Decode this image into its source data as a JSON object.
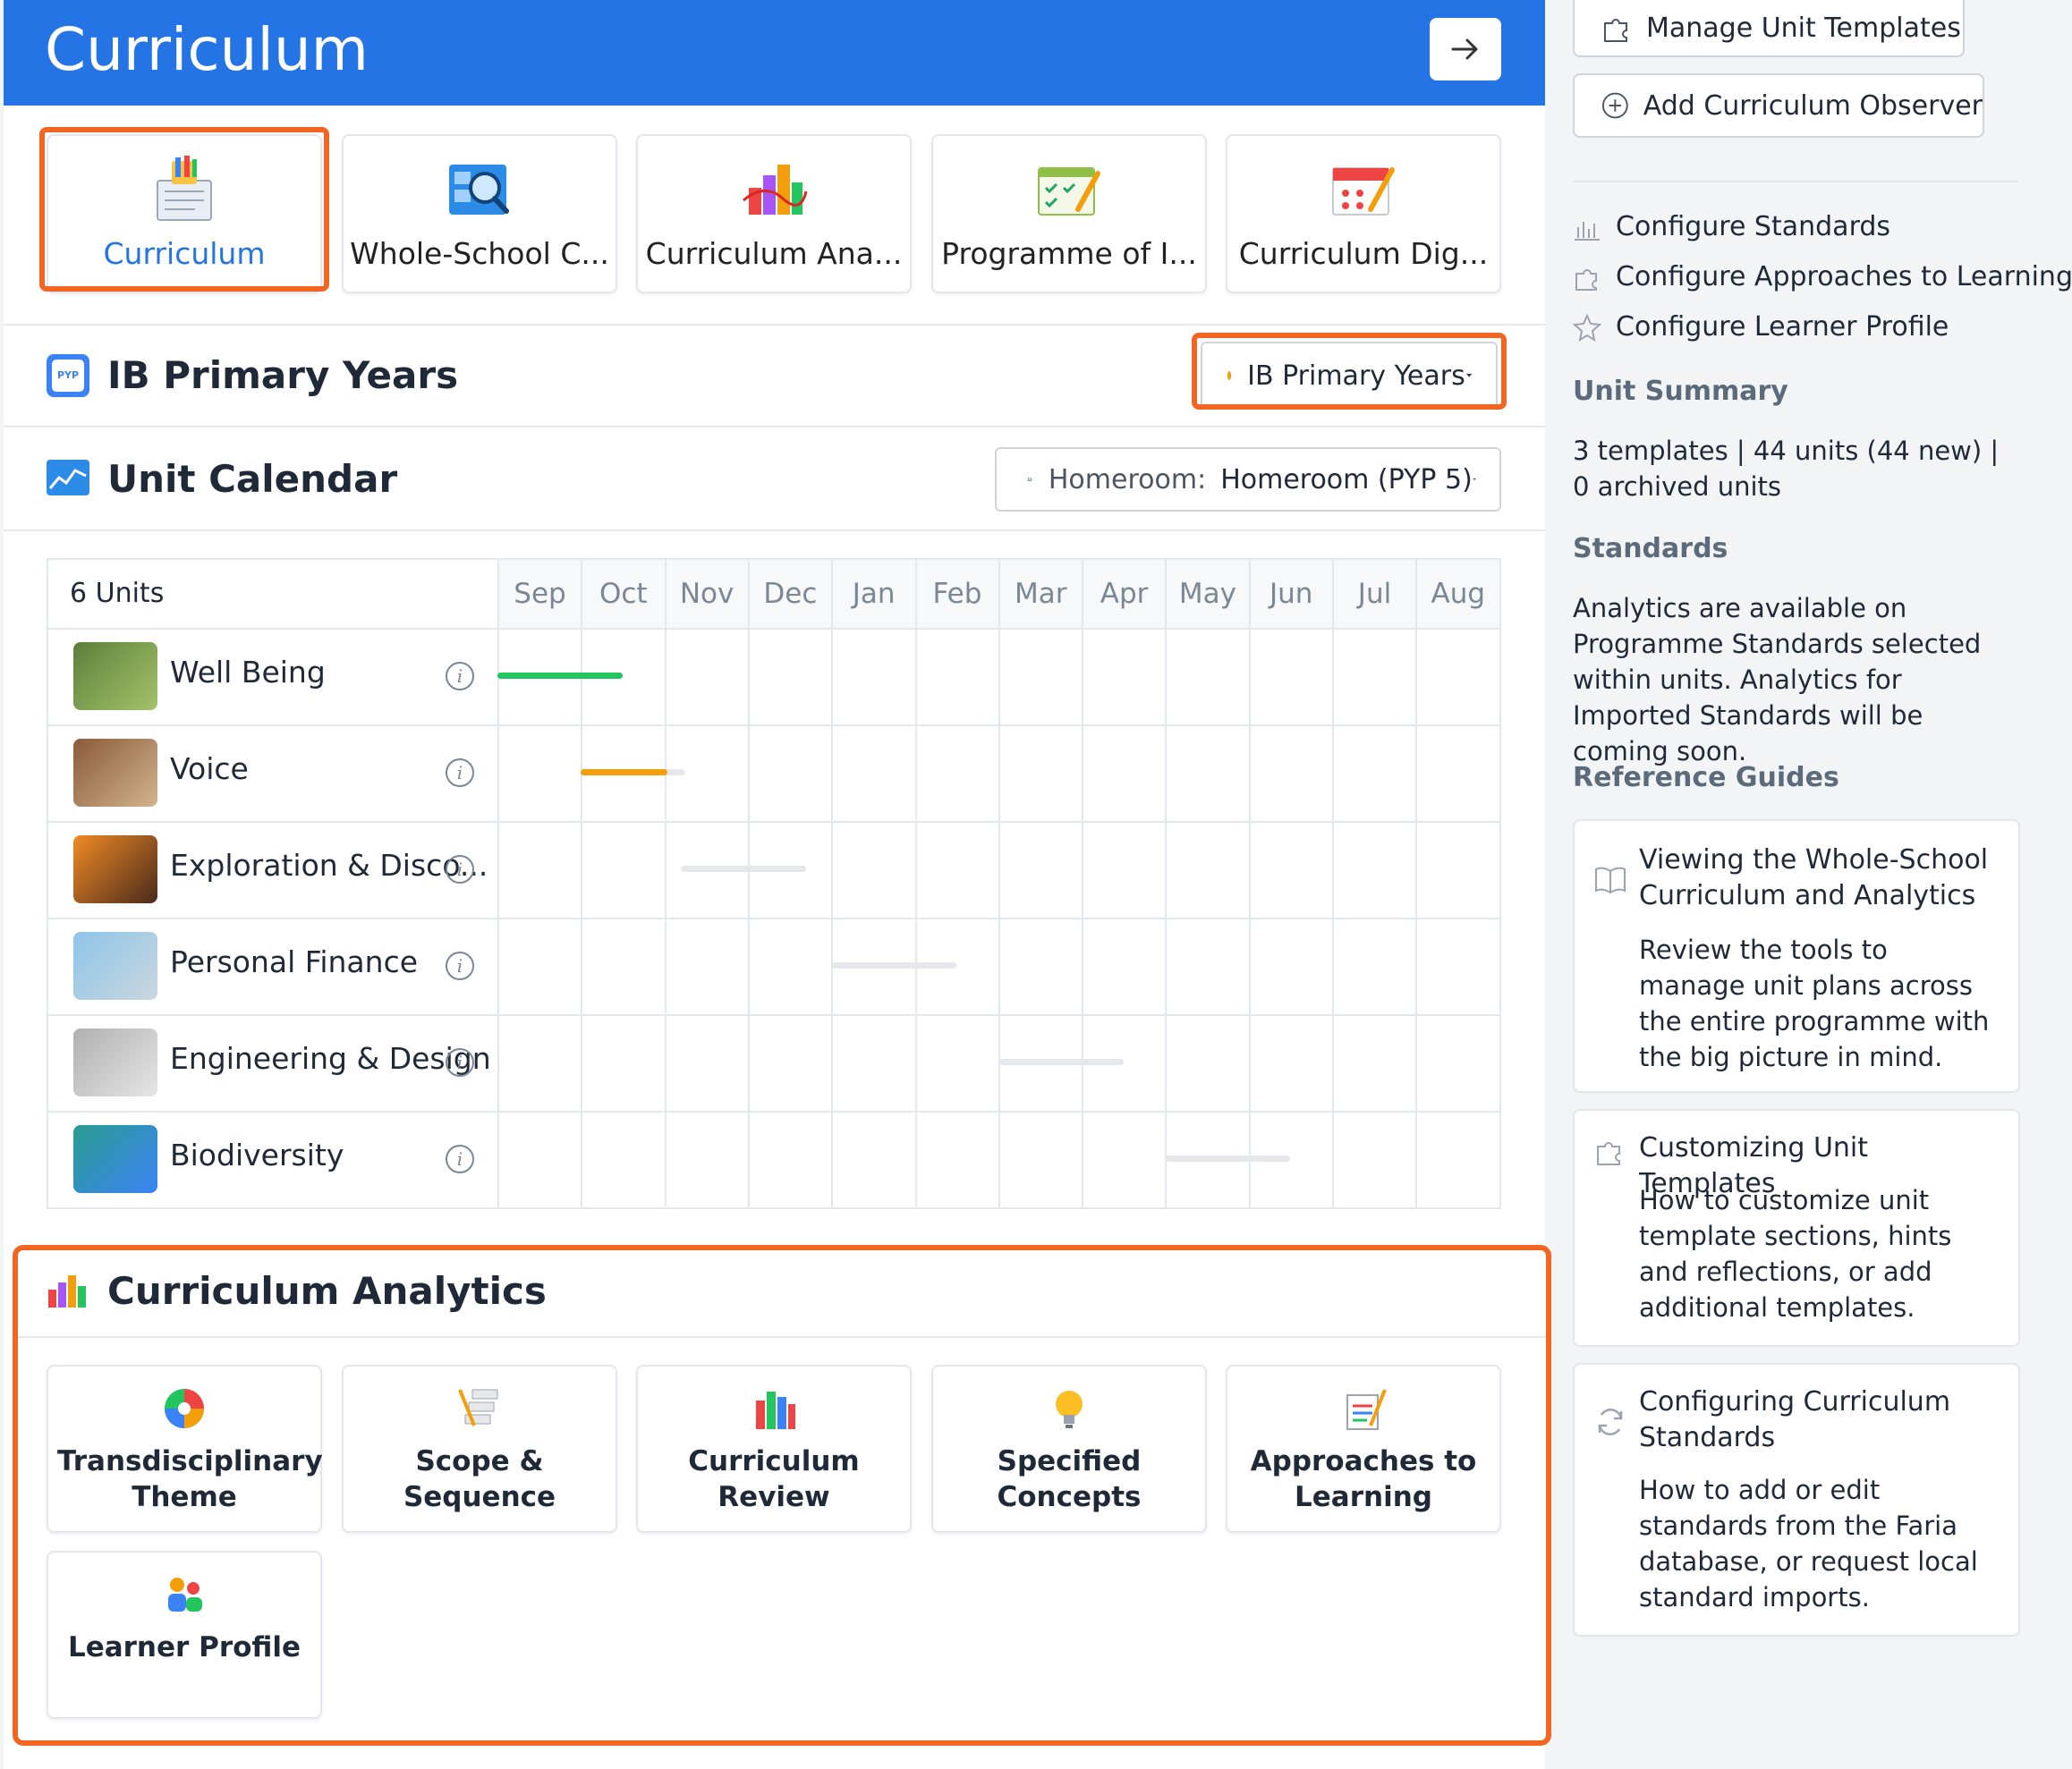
{
  "header": {
    "title": "Curriculum"
  },
  "tools": [
    {
      "label": "Curriculum",
      "icon": "curriculum-notebook-icon"
    },
    {
      "label": "Whole-School C...",
      "icon": "magnifier-icon"
    },
    {
      "label": "Curriculum Ana...",
      "icon": "bar-chart-icon"
    },
    {
      "label": "Programme of I...",
      "icon": "checklist-calendar-icon"
    },
    {
      "label": "Curriculum Dig...",
      "icon": "calendar-pencil-icon"
    }
  ],
  "programme": {
    "badge": "PYP",
    "title": "IB Primary Years",
    "select_value": "IB Primary Years"
  },
  "unit_calendar": {
    "title": "Unit Calendar",
    "homeroom_label": "Homeroom:",
    "homeroom_value": "Homeroom (PYP 5)",
    "units_count": "6 Units",
    "months": [
      "Sep",
      "Oct",
      "Nov",
      "Dec",
      "Jan",
      "Feb",
      "Mar",
      "Apr",
      "May",
      "Jun",
      "Jul",
      "Aug"
    ],
    "units": [
      {
        "name": "Well Being",
        "thumb": "photo-people-outdoors",
        "bar_start_month": 0,
        "bar_months": 1.5,
        "color": "#22c55e"
      },
      {
        "name": "Voice",
        "thumb": "photo-crowd-protest",
        "bar_start_month": 1,
        "bar_months": 1.25,
        "color": "#f59e0b",
        "bar_fill": 0.83
      },
      {
        "name": "Exploration & Disco...",
        "thumb": "photo-sunset-hiker",
        "bar_start_month": 2.2,
        "bar_months": 1.5,
        "color": "#e5e7eb"
      },
      {
        "name": "Personal Finance",
        "thumb": "photo-coins-city",
        "bar_start_month": 4,
        "bar_months": 1.5,
        "color": "#e5e7eb"
      },
      {
        "name": "Engineering & Design",
        "thumb": "photo-gears",
        "bar_start_month": 6,
        "bar_months": 1.5,
        "color": "#e5e7eb"
      },
      {
        "name": "Biodiversity",
        "thumb": "photo-globe-recycle",
        "bar_start_month": 8,
        "bar_months": 1.5,
        "color": "#e5e7eb"
      }
    ]
  },
  "analytics": {
    "title": "Curriculum Analytics",
    "cards": [
      {
        "label": "Transdisciplinary Theme",
        "icon": "color-wheel-icon"
      },
      {
        "label": "Scope & Sequence",
        "icon": "steps-pencil-icon"
      },
      {
        "label": "Curriculum Review",
        "icon": "books-icon"
      },
      {
        "label": "Specified Concepts",
        "icon": "lightbulb-icon"
      },
      {
        "label": "Approaches to Learning",
        "icon": "notepad-icon"
      },
      {
        "label": "Learner Profile",
        "icon": "people-icon"
      }
    ]
  },
  "sidebar": {
    "manage_templates": "Manage Unit Templates",
    "add_observer": "Add Curriculum Observer",
    "links": [
      {
        "label": "Configure Standards",
        "icon": "chart-bars-icon"
      },
      {
        "label": "Configure Approaches to Learning",
        "icon": "puzzle-icon"
      },
      {
        "label": "Configure Learner Profile",
        "icon": "star-icon"
      }
    ],
    "unit_summary_title": "Unit Summary",
    "unit_summary_text": "3 templates | 44 units (44 new) | 0 archived units",
    "standards_title": "Standards",
    "standards_text": "Analytics are available on Programme Standards selected within units. Analytics for Imported Standards will be coming soon.",
    "reference_title": "Reference Guides",
    "guides": [
      {
        "title": "Viewing the Whole-School Curriculum and Analytics",
        "desc": "Review the tools to manage unit plans across the entire programme with the big picture in mind.",
        "icon": "book-icon"
      },
      {
        "title": "Customizing Unit Templates",
        "desc": "How to customize unit template sections, hints and reflections, or add additional templates.",
        "icon": "puzzle-icon"
      },
      {
        "title": "Configuring Curriculum Standards",
        "desc": "How to add or edit standards from the Faria database, or request local standard imports.",
        "icon": "refresh-icon"
      }
    ]
  }
}
